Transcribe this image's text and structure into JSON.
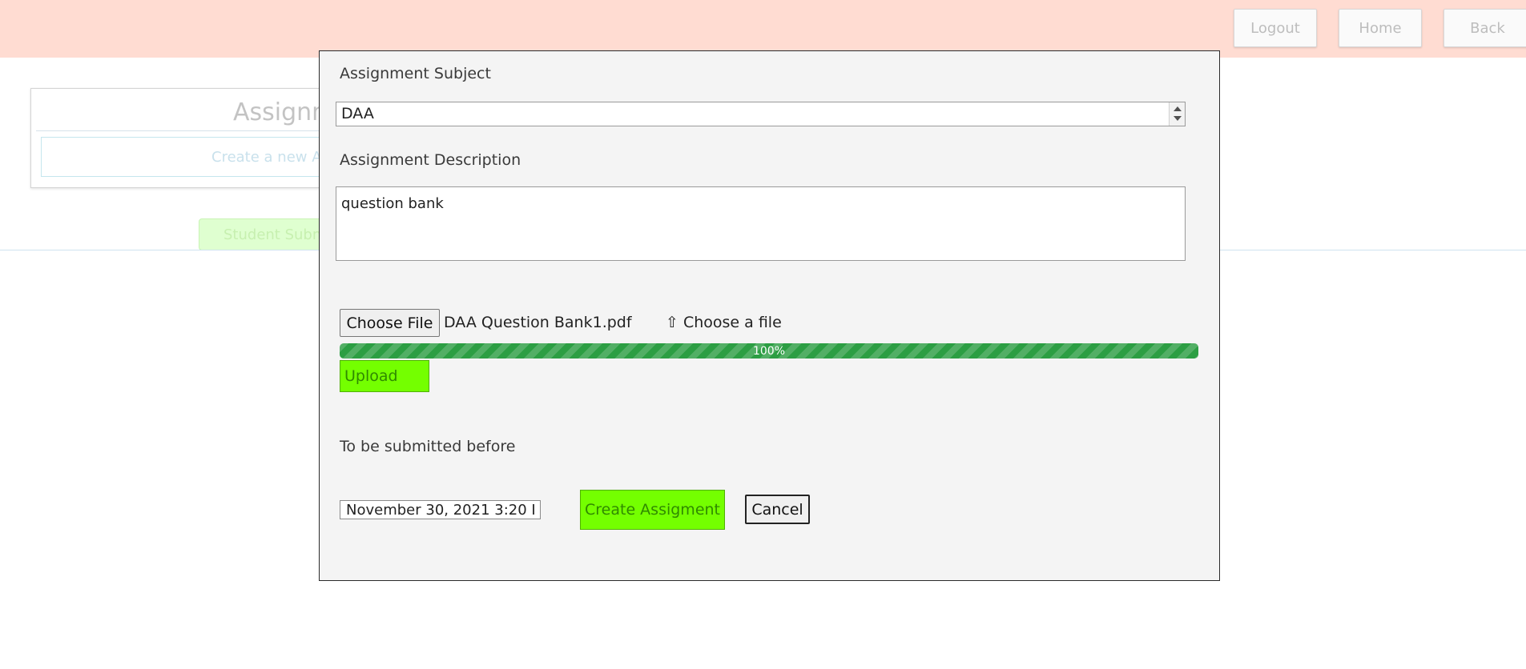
{
  "header": {
    "logout_label": "Logout",
    "home_label": "Home",
    "back_label": "Back"
  },
  "background": {
    "card_title": "Assignm",
    "create_label": "Create a new A",
    "student_label": "Student Subm"
  },
  "modal": {
    "subject_label": "Assignment Subject",
    "subject_value": "DAA",
    "description_label": "Assignment Description",
    "description_value": "question bank",
    "choose_file_button": "Choose File",
    "file_name": "DAA Question Bank1.pdf",
    "choose_file_label": "⇧ Choose a file",
    "progress": 1.0,
    "progress_text": "100%",
    "upload_label": "Upload",
    "deadline_label": "To be submitted before",
    "deadline_value": "November 30, 2021 3:20 I",
    "create_label": "Create Assigment",
    "cancel_label": "Cancel"
  },
  "colors": {
    "topbar": "#ffdcd2",
    "accent_green": "#74ff00",
    "progress_green": "#2c9e43"
  }
}
